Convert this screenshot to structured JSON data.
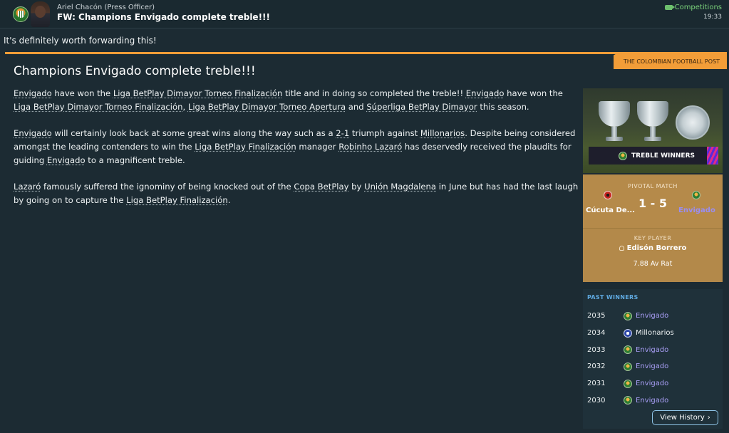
{
  "header": {
    "sender": "Ariel Chacón",
    "sender_role": "(Press Officer)",
    "subject": "FW: Champions Envigado complete treble!!!",
    "competitions_link": "Competitions",
    "time": "19:33"
  },
  "forward_note": "It's definitely worth forwarding this!",
  "article": {
    "publisher": "THE COLOMBIAN FOOTBALL POST",
    "headline": "Champions Envigado complete treble!!!",
    "p1": {
      "a": "Envigado",
      "b": " have won the ",
      "c": "Liga BetPlay Dimayor Torneo Finalización",
      "d": " title and in doing so completed the treble!! ",
      "e": "Envigado",
      "f": " have won the ",
      "g": "Liga BetPlay Dimayor Torneo Finalización",
      "h": ", ",
      "i": "Liga BetPlay Dimayor Torneo Apertura",
      "j": " and ",
      "k": "Súperliga BetPlay Dimayor",
      "l": " this season."
    },
    "p2": {
      "a": "Envigado",
      "b": " will certainly look back at some great wins along the way such as a ",
      "c": "2-1",
      "d": " triumph against ",
      "e": "Millonarios",
      "f": ". Despite being considered amongst the leading contenders to win the ",
      "g": "Liga BetPlay Finalización",
      "h": " manager ",
      "i": "Robinho Lazaró",
      "j": " has deservedly received the plaudits for guiding ",
      "k": "Envigado",
      "l": " to a magnificent treble."
    },
    "p3": {
      "a": "Lazaró",
      "b": " famously suffered the ignominy of being knocked out of the ",
      "c": "Copa BetPlay",
      "d": " by ",
      "e": "Unión Magdalena",
      "f": " in June but has had the last laugh by going on to capture the ",
      "g": "Liga BetPlay Finalización",
      "h": "."
    }
  },
  "treble_card": {
    "label": "TREBLE WINNERS"
  },
  "pivotal_match": {
    "label": "PIVOTAL MATCH",
    "home_team": "Cúcuta De...",
    "score": "1 - 5",
    "away_team": "Envigado",
    "key_player_label": "KEY PLAYER",
    "key_player": "Edisón Borrero",
    "rating": "7.88 Av Rat"
  },
  "past_winners": {
    "title": "PAST WINNERS",
    "rows": [
      {
        "year": "2035",
        "club": "Envigado"
      },
      {
        "year": "2034",
        "club": "Millonarios"
      },
      {
        "year": "2033",
        "club": "Envigado"
      },
      {
        "year": "2032",
        "club": "Envigado"
      },
      {
        "year": "2031",
        "club": "Envigado"
      },
      {
        "year": "2030",
        "club": "Envigado"
      }
    ],
    "view_history": "View History"
  },
  "colors": {
    "background": "#1c2b33",
    "accent_orange": "#f29d38",
    "match_card": "#b3894a",
    "link_purple": "#a89ef5",
    "section_blue": "#5fa9e0"
  },
  "icons": {
    "club_badge": "envigado-badge-icon",
    "competitions": "tag-icon",
    "player": "person-icon",
    "chevron": "chevron-right-icon"
  }
}
